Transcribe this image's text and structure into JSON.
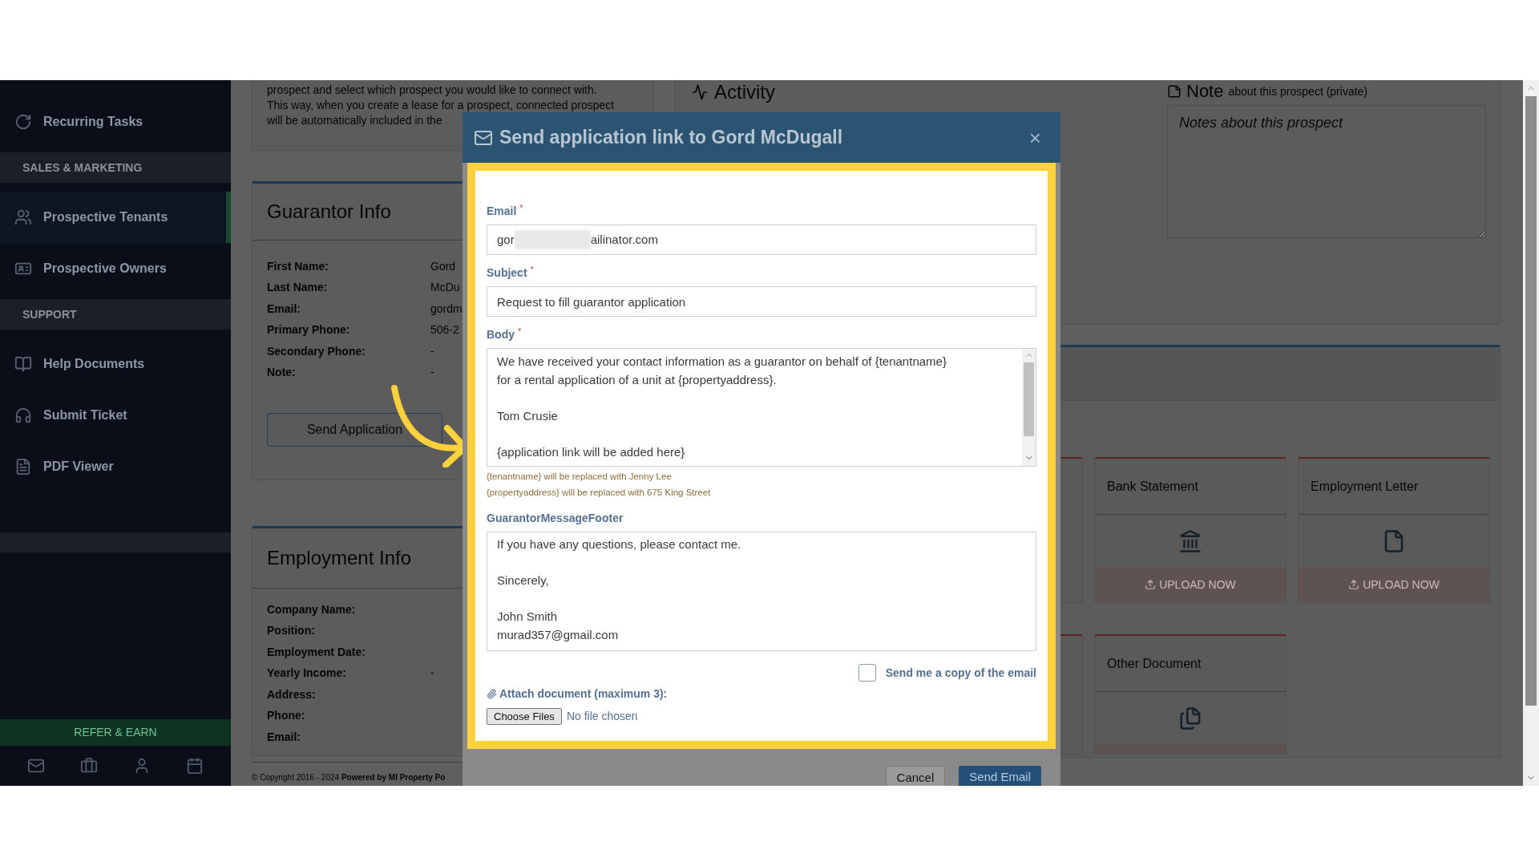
{
  "sidebar": {
    "items": [
      {
        "kind": "item",
        "label": "Recurring Tasks",
        "selected": false
      },
      {
        "kind": "section",
        "label": "SALES & MARKETING"
      },
      {
        "kind": "item",
        "label": "Prospective Tenants",
        "selected": true
      },
      {
        "kind": "item",
        "label": "Prospective Owners",
        "selected": false
      },
      {
        "kind": "section",
        "label": "SUPPORT"
      },
      {
        "kind": "item",
        "label": "Help Documents",
        "selected": false
      },
      {
        "kind": "item",
        "label": "Submit Ticket",
        "selected": false
      },
      {
        "kind": "item",
        "label": "PDF Viewer",
        "selected": false
      },
      {
        "kind": "divider"
      }
    ],
    "refer_button": "REFER & EARN"
  },
  "info_card": {
    "lines": [
      "prospect and select which prospect you would like to connect with.",
      "This way, when you create a lease for a prospect, connected prospect",
      "will be automatically included in the"
    ]
  },
  "guarantor_info": {
    "title": "Guarantor Info",
    "rows": [
      {
        "label": "First Name:",
        "value": "Gord"
      },
      {
        "label": "Last Name:",
        "value": "McDu"
      },
      {
        "label": "Email:",
        "value": "gordm"
      },
      {
        "label": "Primary Phone:",
        "value": "506-2"
      },
      {
        "label": "Secondary Phone:",
        "value": "-"
      },
      {
        "label": "Note:",
        "value": "-"
      }
    ],
    "button": "Send Application"
  },
  "employment_info": {
    "title": "Employment Info",
    "rows": [
      {
        "label": "Company Name:"
      },
      {
        "label": "Position:"
      },
      {
        "label": "Employment Date:"
      },
      {
        "label": "Yearly Income:",
        "value": "-"
      },
      {
        "label": "Address:"
      },
      {
        "label": "Phone:"
      },
      {
        "label": "Email:"
      }
    ]
  },
  "copyright": "© Copyright 2016 - 2024 **Powered by MI Property Po**",
  "activity": {
    "title": "Activity"
  },
  "note": {
    "title": "Note",
    "subtitle": "about this prospect (private)",
    "placeholder": "Notes about this prospect"
  },
  "documents": [
    {
      "title": "Bank Statement",
      "upload_label": "UPLOAD NOW"
    },
    {
      "title": "Employment Letter",
      "upload_label": "UPLOAD NOW"
    },
    {
      "title": "Other Document"
    }
  ],
  "modal": {
    "title": "Send application link to Gord McDugall",
    "close": "×",
    "email": {
      "label": "Email",
      "required_mark": "*",
      "visible_start": "gor",
      "visible_end": "ailinator.com"
    },
    "subject": {
      "label": "Subject",
      "required_mark": "*",
      "value": "Request to fill guarantor application"
    },
    "body": {
      "label": "Body",
      "required_mark": "*",
      "value": "We have received your contact information as a guarantor on behalf of {tenantname}\nfor a rental application of a unit at {propertyaddress}.\n\nTom Crusie\n\n{application link will be added here}"
    },
    "hints": [
      "{tenantname} will be replaced with Jenny Lee",
      "{propertyaddress} will be replaced with 675 King Street"
    ],
    "footer_message": {
      "label": "GuarantorMessageFooter",
      "value": "If you have any questions, please contact me.\n\nSincerely,\n\nJohn Smith\nmurad357@gmail.com"
    },
    "copy_checkbox": {
      "label": "Send me a copy of the email",
      "checked": false
    },
    "attach": {
      "label": "Attach document (maximum 3):",
      "button": "Choose Files",
      "status": "No file chosen"
    },
    "buttons": [
      {
        "kind": "secondary",
        "label": "Cancel"
      },
      {
        "kind": "primary",
        "label": "Send Email"
      }
    ]
  }
}
